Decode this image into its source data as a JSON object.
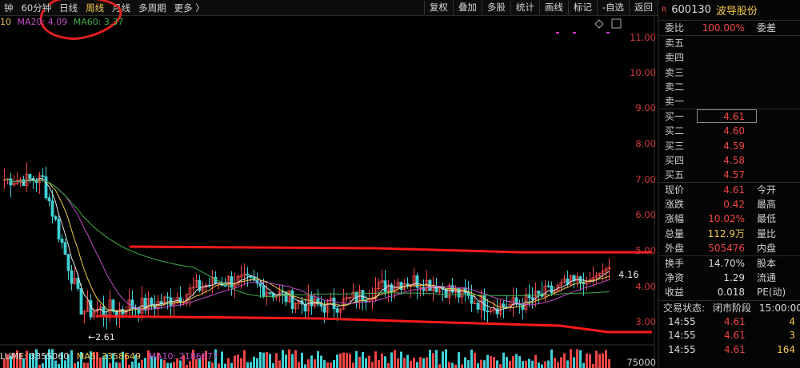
{
  "toolbar": {
    "left": [
      "钟",
      "60分钟",
      "日线",
      "周线",
      "月线",
      "多周期",
      "更多 〉"
    ],
    "right": [
      "复权",
      "叠加",
      "多股",
      "统计",
      "画线",
      "标记",
      "-自选",
      "返回"
    ]
  },
  "ma_legend": {
    "ma10": "10",
    "ma20": "MA20: 4.09",
    "ma60": "MA60: 3.37"
  },
  "price_axis": [
    "11.00",
    "10.00",
    "9.00",
    "8.00",
    "7.00",
    "6.00",
    "5.00",
    "4.00",
    "3.00"
  ],
  "vol_axis_label": "75000",
  "current_price_tag": "4.16",
  "low_marker": "←2.61",
  "volume_row": {
    "volume": "LUME: 3355060",
    "ma5": "MA5: 3358649",
    "ma10": "MA10: 2186877"
  },
  "stock": {
    "badge": "R",
    "code": "600130",
    "name": "波导股份"
  },
  "order_book": {
    "weibi_label": "委比",
    "weibi_value": "100.00%",
    "weicha_label": "委差",
    "sell": [
      "卖五",
      "卖四",
      "卖三",
      "卖二",
      "卖一"
    ],
    "buy": [
      {
        "label": "买一",
        "price": "4.61"
      },
      {
        "label": "买二",
        "price": "4.60"
      },
      {
        "label": "买三",
        "price": "4.59"
      },
      {
        "label": "买四",
        "price": "4.58"
      },
      {
        "label": "买五",
        "price": "4.57"
      }
    ]
  },
  "quote": [
    {
      "label": "现价",
      "value": "4.61",
      "label2": "今开"
    },
    {
      "label": "涨跌",
      "value": "0.42",
      "label2": "最高"
    },
    {
      "label": "涨幅",
      "value": "10.02%",
      "label2": "最低"
    },
    {
      "label": "总量",
      "value": "112.9万",
      "label2": "量比"
    },
    {
      "label": "外盘",
      "value": "505476",
      "label2": "内盘"
    }
  ],
  "stats": [
    {
      "label": "换手",
      "value": "14.70%",
      "label2": "股本"
    },
    {
      "label": "净资",
      "value": "1.29",
      "label2": "流通"
    },
    {
      "label": "收益",
      "value": "0.018",
      "label2": "PE(动)"
    }
  ],
  "trade_status": {
    "label": "交易状态:",
    "phase": "闭市阶段",
    "time": "15:00:00"
  },
  "ticks": [
    {
      "time": "14:55",
      "price": "4.61",
      "vol": "4"
    },
    {
      "time": "14:55",
      "price": "4.61",
      "vol": "3"
    },
    {
      "time": "14:55",
      "price": "4.61",
      "vol": "164"
    }
  ],
  "colors": {
    "up": "#ef4545",
    "ma5": "#e0e0e0",
    "ma10": "#f2c94c",
    "ma20": "#c44cc8",
    "ma60": "#3fae4a"
  }
}
